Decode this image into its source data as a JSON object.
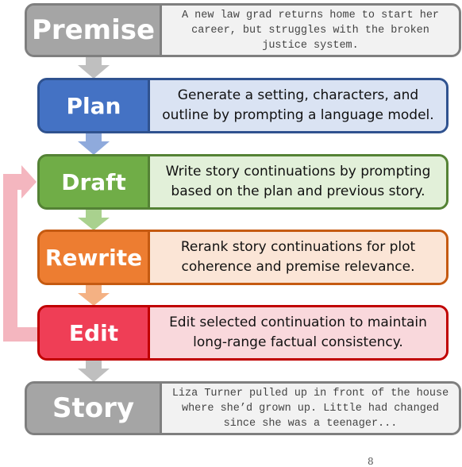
{
  "diagram": {
    "stages": [
      {
        "id": "premise",
        "label": "Premise",
        "description": "A new law grad returns home to start her career, but struggles with the broken justice system.",
        "style": "monospace",
        "color": "#a5a5a5",
        "fill": "#f2f2f2"
      },
      {
        "id": "plan",
        "label": "Plan",
        "description": "Generate a setting, characters, and outline by prompting a language model.",
        "style": "sans",
        "color": "#4472c4",
        "fill": "#dae3f3"
      },
      {
        "id": "draft",
        "label": "Draft",
        "description": "Write story continuations by prompting based on the plan and previous story.",
        "style": "sans",
        "color": "#70ad47",
        "fill": "#e2f0d9"
      },
      {
        "id": "rewrite",
        "label": "Rewrite",
        "description": "Rerank story continuations for plot coherence and premise relevance.",
        "style": "sans",
        "color": "#ed7d31",
        "fill": "#fbe5d6"
      },
      {
        "id": "edit",
        "label": "Edit",
        "description": "Edit selected continuation to maintain long-range factual consistency.",
        "style": "sans",
        "color": "#ef3e56",
        "fill": "#f9d8dc"
      },
      {
        "id": "story",
        "label": "Story",
        "description": "Liza Turner pulled up in front of the house where she’d grown up. Little had changed since she was a teenager...",
        "style": "monospace",
        "color": "#a5a5a5",
        "fill": "#f2f2f2"
      }
    ],
    "arrows": [
      {
        "from": "premise",
        "to": "plan",
        "color": "#bfbfbf"
      },
      {
        "from": "plan",
        "to": "draft",
        "color": "#8faadc"
      },
      {
        "from": "draft",
        "to": "rewrite",
        "color": "#a9d18e"
      },
      {
        "from": "rewrite",
        "to": "edit",
        "color": "#f4b183"
      },
      {
        "from": "edit",
        "to": "story",
        "color": "#bfbfbf"
      }
    ],
    "loop": {
      "from": "edit",
      "to": "draft",
      "color": "#f4b6bf"
    },
    "footer_fragment": "8"
  }
}
